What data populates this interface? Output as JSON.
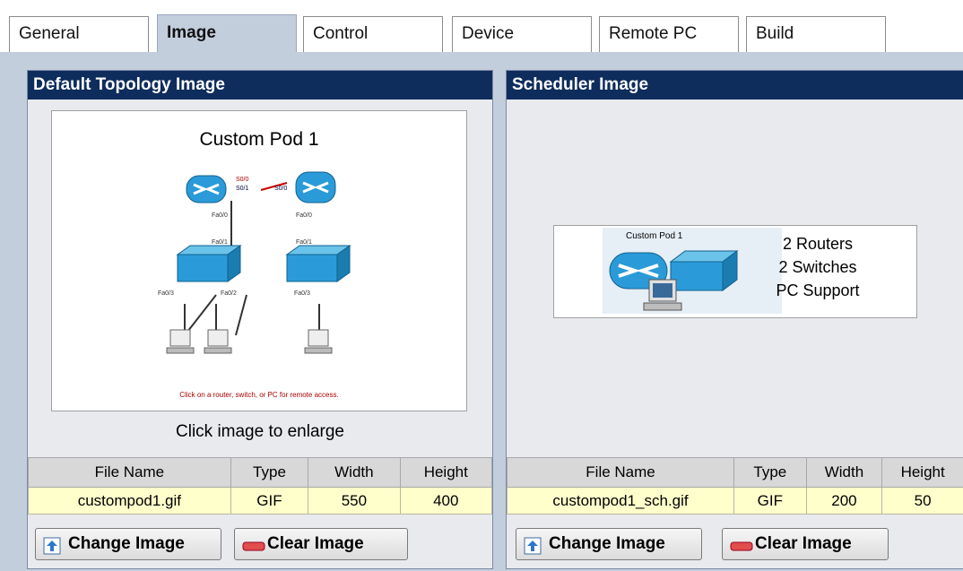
{
  "tabs": [
    {
      "label": "General"
    },
    {
      "label": "Image"
    },
    {
      "label": "Control"
    },
    {
      "label": "Device"
    },
    {
      "label": "Remote PC"
    },
    {
      "label": "Build"
    }
  ],
  "active_tab": "Image",
  "left_panel": {
    "title": "Default Topology Image",
    "caption": "Click image to enlarge",
    "topology": {
      "title": "Custom Pod 1",
      "footer_note": "Click on a router, switch, or PC for remote access."
    },
    "table": {
      "headers": [
        "File Name",
        "Type",
        "Width",
        "Height"
      ],
      "row": [
        "custompod1.gif",
        "GIF",
        "550",
        "400"
      ]
    },
    "buttons": {
      "change": "Change Image",
      "clear": "Clear Image"
    }
  },
  "right_panel": {
    "title": "Scheduler Image",
    "scheduler_thumb": {
      "title": "Custom Pod 1",
      "line1": "2 Routers",
      "line2": "2 Switches",
      "line3": "PC Support"
    },
    "table": {
      "headers": [
        "File Name",
        "Type",
        "Width",
        "Height"
      ],
      "row": [
        "custompod1_sch.gif",
        "GIF",
        "200",
        "50"
      ]
    },
    "buttons": {
      "change": "Change Image",
      "clear": "Clear Image"
    }
  },
  "colors": {
    "header_bg": "#0e2c5c",
    "frame_bg": "#c3cedd",
    "cell_bg": "#ffffcc"
  }
}
